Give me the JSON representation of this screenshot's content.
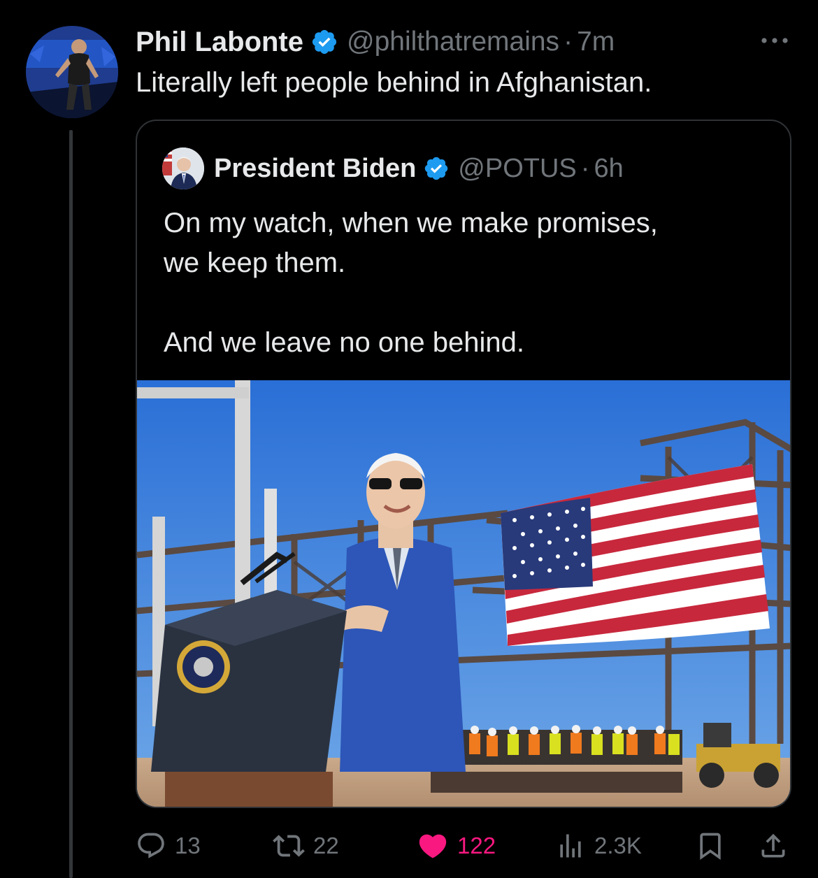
{
  "colors": {
    "background": "#000000",
    "text_primary": "#e7e9ea",
    "text_secondary": "#71767b",
    "verified_blue": "#1d9bf0",
    "like_pink": "#f91880",
    "border": "#2f3336"
  },
  "tweet": {
    "author": {
      "display_name": "Phil Labonte",
      "handle": "@philthatremains",
      "verified_icon": "verified-badge-icon",
      "avatar_icon": "avatar"
    },
    "dot": "·",
    "time": "7m",
    "more_icon": "more-options-icon",
    "text": "Literally left people behind in Afghanistan.",
    "quoted": {
      "author": {
        "display_name": "President Biden",
        "handle": "@POTUS",
        "verified_icon": "verified-badge-icon"
      },
      "dot": "·",
      "time": "6h",
      "text_lines": [
        "On my watch, when we make promises,",
        "we keep them.",
        "And we leave no one behind."
      ],
      "media_icon": "photo"
    },
    "actions": {
      "reply": {
        "icon": "reply-icon",
        "count": "13"
      },
      "retweet": {
        "icon": "retweet-icon",
        "count": "22"
      },
      "like": {
        "icon": "heart-icon",
        "count": "122",
        "liked": true
      },
      "views": {
        "icon": "views-icon",
        "count": "2.3K"
      },
      "bookmark": {
        "icon": "bookmark-icon"
      },
      "share": {
        "icon": "share-icon"
      }
    }
  }
}
